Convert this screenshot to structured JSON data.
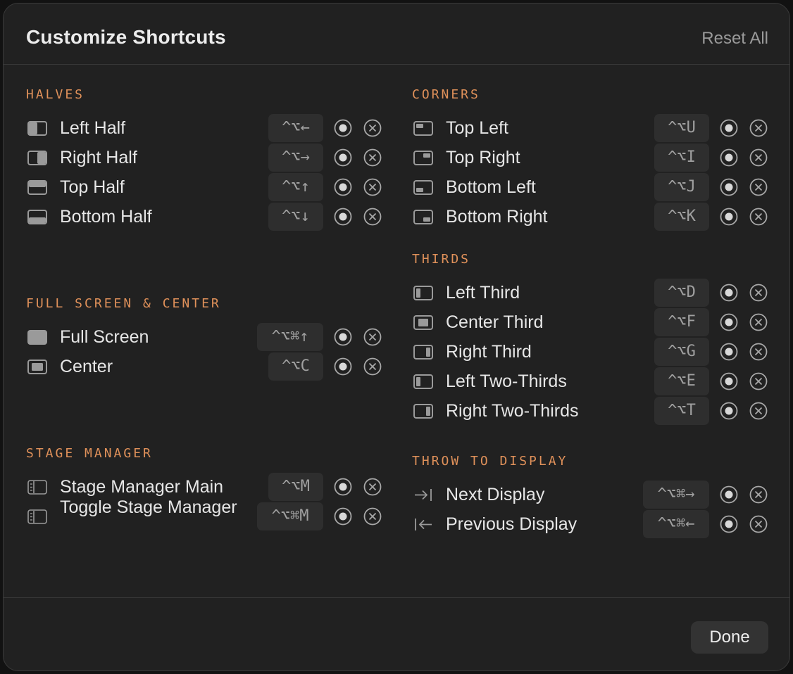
{
  "dialog": {
    "title": "Customize Shortcuts",
    "reset_label": "Reset All",
    "done_label": "Done"
  },
  "colors": {
    "accent": "#e0915a",
    "background": "#212121",
    "text": "#e6e6e6",
    "key_bg": "#2e2e2e"
  },
  "sections": {
    "halves": {
      "title": "HALVES",
      "items": [
        {
          "label": "Left Half",
          "icon": "left-half-icon",
          "shortcut": "^⌥←"
        },
        {
          "label": "Right Half",
          "icon": "right-half-icon",
          "shortcut": "^⌥→"
        },
        {
          "label": "Top Half",
          "icon": "top-half-icon",
          "shortcut": "^⌥↑"
        },
        {
          "label": "Bottom Half",
          "icon": "bottom-half-icon",
          "shortcut": "^⌥↓"
        }
      ]
    },
    "fullscreen": {
      "title": "FULL SCREEN & CENTER",
      "items": [
        {
          "label": "Full Screen",
          "icon": "full-screen-icon",
          "shortcut": "^⌥⌘↑"
        },
        {
          "label": "Center",
          "icon": "center-icon",
          "shortcut": "^⌥C"
        }
      ]
    },
    "stage": {
      "title": "STAGE MANAGER",
      "items": [
        {
          "label": "Stage Manager Main",
          "icon": "stage-manager-icon",
          "shortcut": "^⌥M"
        },
        {
          "label": "Toggle Stage Manager",
          "icon": "stage-manager-icon",
          "shortcut": "^⌥⌘M"
        }
      ]
    },
    "corners": {
      "title": "CORNERS",
      "items": [
        {
          "label": "Top Left",
          "icon": "top-left-icon",
          "shortcut": "^⌥U"
        },
        {
          "label": "Top Right",
          "icon": "top-right-icon",
          "shortcut": "^⌥I"
        },
        {
          "label": "Bottom Left",
          "icon": "bottom-left-icon",
          "shortcut": "^⌥J"
        },
        {
          "label": "Bottom Right",
          "icon": "bottom-right-icon",
          "shortcut": "^⌥K"
        }
      ]
    },
    "thirds": {
      "title": "THIRDS",
      "items": [
        {
          "label": "Left Third",
          "icon": "left-third-icon",
          "shortcut": "^⌥D"
        },
        {
          "label": "Center Third",
          "icon": "center-third-icon",
          "shortcut": "^⌥F"
        },
        {
          "label": "Right Third",
          "icon": "right-third-icon",
          "shortcut": "^⌥G"
        },
        {
          "label": "Left Two-Thirds",
          "icon": "left-third-icon",
          "shortcut": "^⌥E"
        },
        {
          "label": "Right Two-Thirds",
          "icon": "right-third-icon",
          "shortcut": "^⌥T"
        }
      ]
    },
    "display": {
      "title": "THROW TO DISPLAY",
      "items": [
        {
          "label": "Next Display",
          "icon": "next-display-icon",
          "shortcut": "^⌥⌘→"
        },
        {
          "label": "Previous Display",
          "icon": "previous-display-icon",
          "shortcut": "^⌥⌘←"
        }
      ]
    }
  }
}
